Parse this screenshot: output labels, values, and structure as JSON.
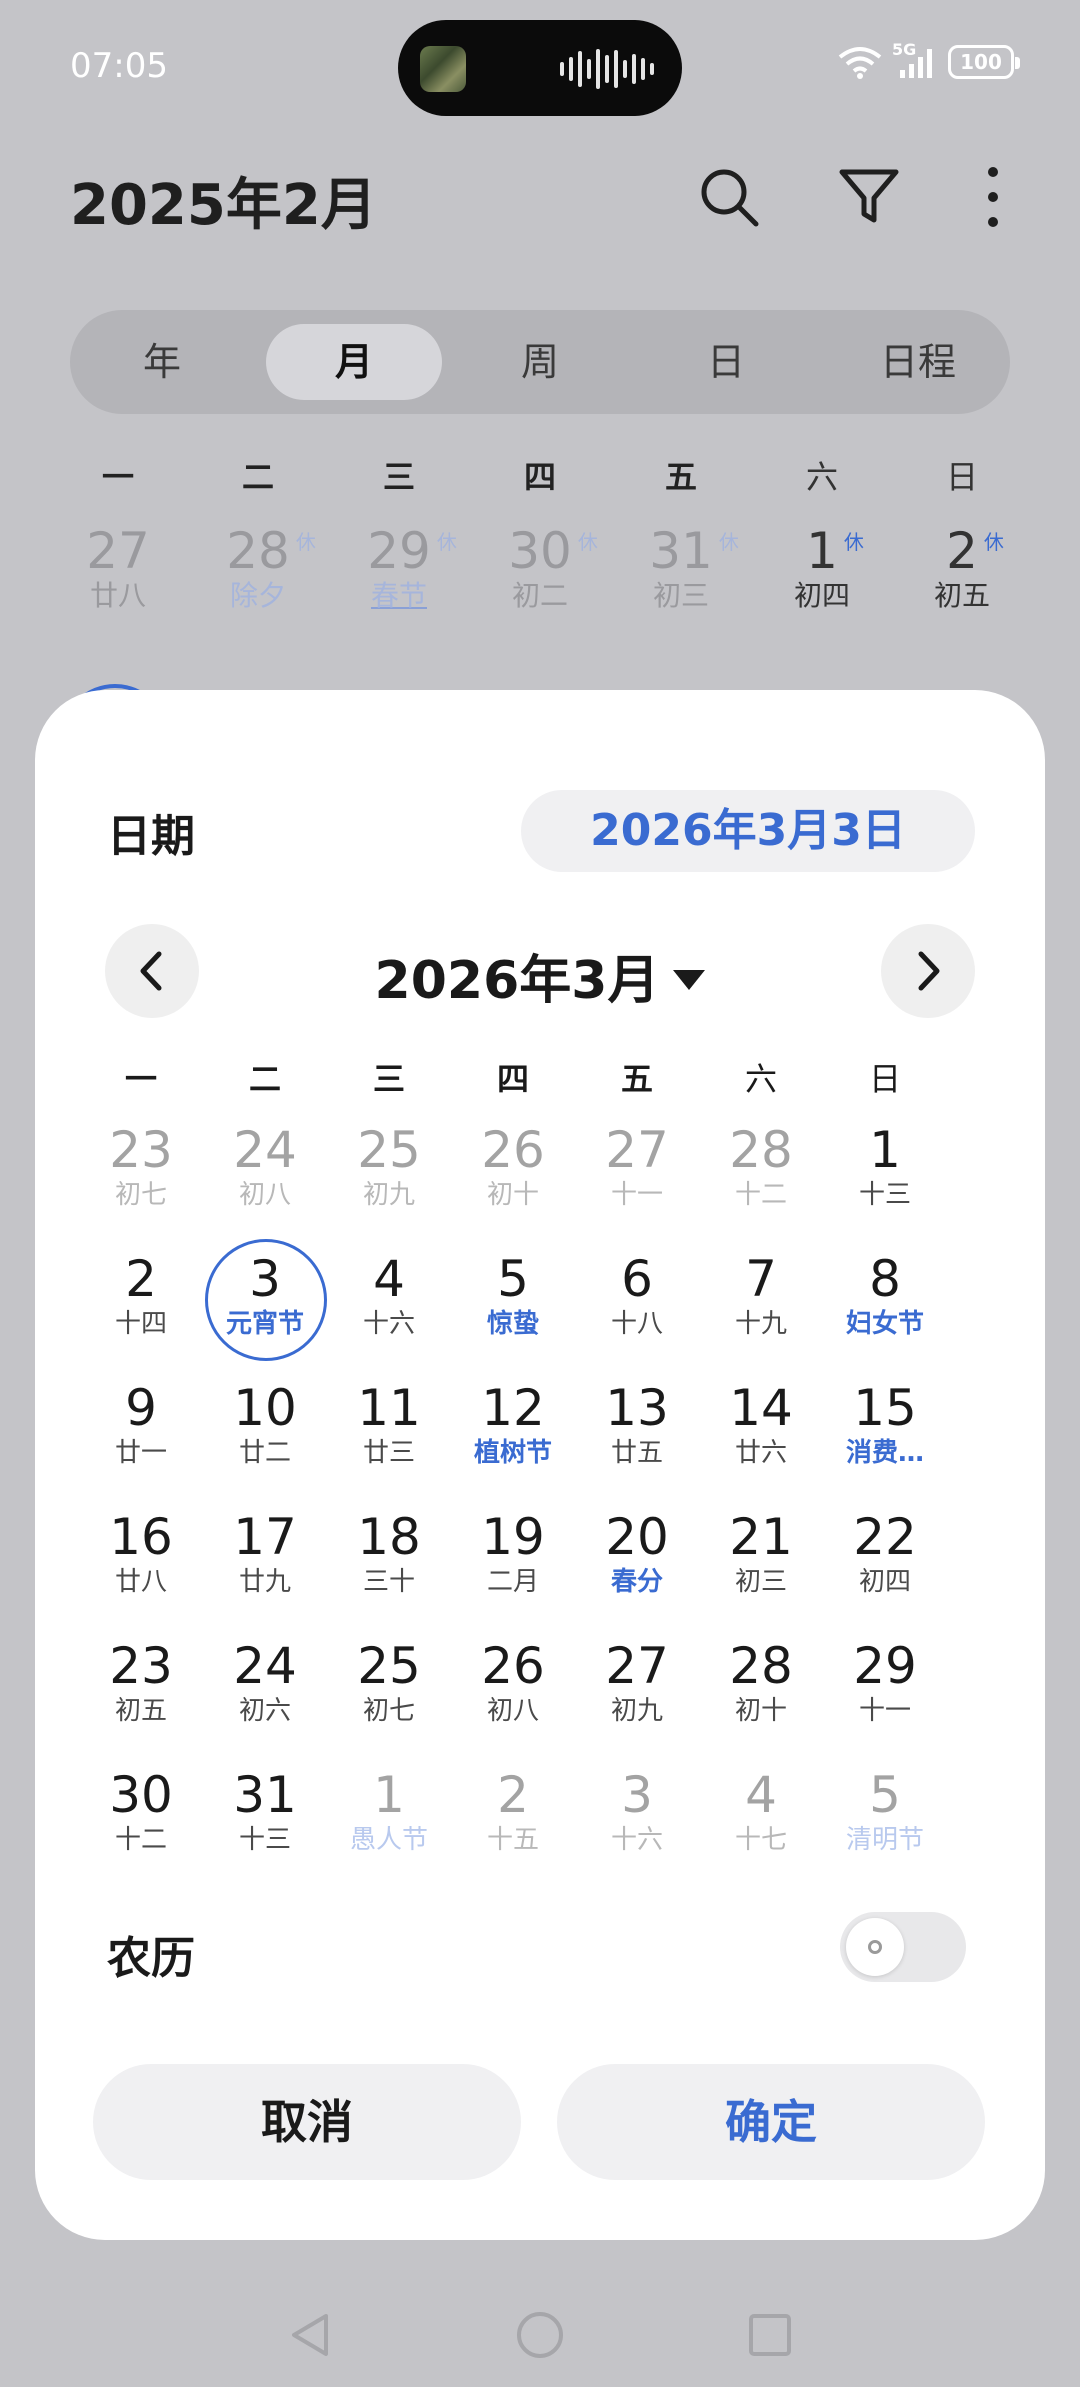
{
  "status_bar": {
    "time": "07:05",
    "network": "5G",
    "battery": "100"
  },
  "header": {
    "title": "2025年2月"
  },
  "view_tabs": [
    {
      "label": "年",
      "active": false
    },
    {
      "label": "月",
      "active": true
    },
    {
      "label": "周",
      "active": false
    },
    {
      "label": "日",
      "active": false
    },
    {
      "label": "日程",
      "active": false
    }
  ],
  "background_calendar": {
    "weekdays": [
      "一",
      "二",
      "三",
      "四",
      "五",
      "六",
      "日"
    ],
    "days": [
      {
        "num": "27",
        "lunar": "廿八",
        "rest": ""
      },
      {
        "num": "28",
        "lunar": "除夕",
        "rest": "休"
      },
      {
        "num": "29",
        "lunar": "春节",
        "rest": "休"
      },
      {
        "num": "30",
        "lunar": "初二",
        "rest": "休"
      },
      {
        "num": "31",
        "lunar": "初三",
        "rest": "休"
      },
      {
        "num": "1",
        "lunar": "初四",
        "rest": "休"
      },
      {
        "num": "2",
        "lunar": "初五",
        "rest": "休"
      }
    ]
  },
  "picker": {
    "date_label": "日期",
    "selected_date": "2026年3月3日",
    "month_title": "2026年3月",
    "weekdays": [
      "一",
      "二",
      "三",
      "四",
      "五",
      "六",
      "日"
    ],
    "days": [
      {
        "num": "23",
        "lunar": "初七"
      },
      {
        "num": "24",
        "lunar": "初八"
      },
      {
        "num": "25",
        "lunar": "初九"
      },
      {
        "num": "26",
        "lunar": "初十"
      },
      {
        "num": "27",
        "lunar": "十一"
      },
      {
        "num": "28",
        "lunar": "十二"
      },
      {
        "num": "1",
        "lunar": "十三"
      },
      {
        "num": "2",
        "lunar": "十四"
      },
      {
        "num": "3",
        "lunar": "元宵节"
      },
      {
        "num": "4",
        "lunar": "十六"
      },
      {
        "num": "5",
        "lunar": "惊蛰"
      },
      {
        "num": "6",
        "lunar": "十八"
      },
      {
        "num": "7",
        "lunar": "十九"
      },
      {
        "num": "8",
        "lunar": "妇女节"
      },
      {
        "num": "9",
        "lunar": "廿一"
      },
      {
        "num": "10",
        "lunar": "廿二"
      },
      {
        "num": "11",
        "lunar": "廿三"
      },
      {
        "num": "12",
        "lunar": "植树节"
      },
      {
        "num": "13",
        "lunar": "廿五"
      },
      {
        "num": "14",
        "lunar": "廿六"
      },
      {
        "num": "15",
        "lunar": "消费…"
      },
      {
        "num": "16",
        "lunar": "廿八"
      },
      {
        "num": "17",
        "lunar": "廿九"
      },
      {
        "num": "18",
        "lunar": "三十"
      },
      {
        "num": "19",
        "lunar": "二月"
      },
      {
        "num": "20",
        "lunar": "春分"
      },
      {
        "num": "21",
        "lunar": "初三"
      },
      {
        "num": "22",
        "lunar": "初四"
      },
      {
        "num": "23",
        "lunar": "初五"
      },
      {
        "num": "24",
        "lunar": "初六"
      },
      {
        "num": "25",
        "lunar": "初七"
      },
      {
        "num": "26",
        "lunar": "初八"
      },
      {
        "num": "27",
        "lunar": "初九"
      },
      {
        "num": "28",
        "lunar": "初十"
      },
      {
        "num": "29",
        "lunar": "十一"
      },
      {
        "num": "30",
        "lunar": "十二"
      },
      {
        "num": "31",
        "lunar": "十三"
      },
      {
        "num": "1",
        "lunar": "愚人节"
      },
      {
        "num": "2",
        "lunar": "十五"
      },
      {
        "num": "3",
        "lunar": "十六"
      },
      {
        "num": "4",
        "lunar": "十七"
      },
      {
        "num": "5",
        "lunar": "清明节"
      }
    ],
    "lunar_label": "农历",
    "lunar_toggle_on": false,
    "cancel_label": "取消",
    "confirm_label": "确定"
  },
  "colors": {
    "accent": "#3a6bd1",
    "scrim": "#c4c4c8",
    "sheet": "#ffffff"
  }
}
